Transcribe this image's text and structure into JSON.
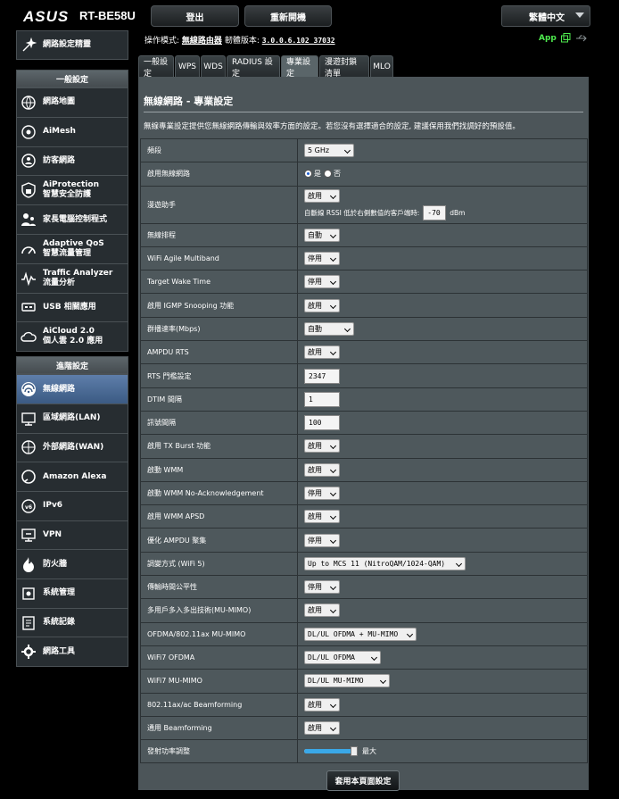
{
  "header": {
    "logo": "ASUS",
    "model": "RT-BE58U",
    "logout_label": "登出",
    "reboot_label": "重新開機",
    "language": "繁體中文"
  },
  "status": {
    "mode_label": "操作模式:",
    "mode_value": "無線路由器",
    "fw_label": "韌體版本:",
    "fw_value": "3.0.0.6.102_37032",
    "app_label": "App"
  },
  "sidebar": {
    "quick": "網路設定精靈",
    "general_header": "一般設定",
    "general": [
      {
        "label": "網路地圖",
        "icon": "globe-icon"
      },
      {
        "label": "AiMesh",
        "icon": "aimesh-icon"
      },
      {
        "label": "訪客網路",
        "icon": "guest-network-icon"
      },
      {
        "label": "AiProtection\n智慧安全防護",
        "icon": "shield-icon"
      },
      {
        "label": "家長電腦控制程式",
        "icon": "parental-control-icon"
      },
      {
        "label": "Adaptive QoS\n智慧流量管理",
        "icon": "qos-icon"
      },
      {
        "label": "Traffic Analyzer\n流量分析",
        "icon": "traffic-icon"
      },
      {
        "label": "USB 相關應用",
        "icon": "usb-icon"
      },
      {
        "label": "AiCloud 2.0\n個人雲 2.0 應用",
        "icon": "cloud-icon"
      }
    ],
    "advanced_header": "進階設定",
    "advanced": [
      {
        "label": "無線網路",
        "icon": "wireless-icon",
        "active": true
      },
      {
        "label": "區域網路(LAN)",
        "icon": "lan-icon"
      },
      {
        "label": "外部網路(WAN)",
        "icon": "wan-icon"
      },
      {
        "label": "Amazon Alexa",
        "icon": "alexa-icon"
      },
      {
        "label": "IPv6",
        "icon": "ipv6-icon"
      },
      {
        "label": "VPN",
        "icon": "vpn-icon"
      },
      {
        "label": "防火牆",
        "icon": "firewall-icon"
      },
      {
        "label": "系統管理",
        "icon": "admin-icon"
      },
      {
        "label": "系統記錄",
        "icon": "log-icon"
      },
      {
        "label": "網路工具",
        "icon": "tools-icon"
      }
    ]
  },
  "tabs": [
    "一般設定",
    "WPS",
    "WDS",
    "RADIUS 設定",
    "專業設定",
    "漫遊封鎖清單",
    "MLO"
  ],
  "active_tab": 4,
  "panel": {
    "title": "無線網路 - 專業設定",
    "description": "無線專業設定提供您無線網路傳輸與效率方面的設定。若您沒有選擇適合的設定, 建議保用我們找調好的預設值。",
    "apply_label": "套用本頁面設定"
  },
  "settings": [
    {
      "label": "頻段",
      "type": "select",
      "value": "5 GHz",
      "w": 56
    },
    {
      "label": "啟用無線網路",
      "type": "radio",
      "yes": "是",
      "no": "否",
      "selected": "yes"
    },
    {
      "label": "漫遊助手",
      "type": "roaming",
      "value": "啟用",
      "hint": "自斷線 RSSI 低於右側數值的客戶端時:",
      "rssi": "-70",
      "unit": "dBm"
    },
    {
      "label": "無線排程",
      "type": "select",
      "value": "自動",
      "w": 40
    },
    {
      "label": "WiFi Agile Multiband",
      "type": "select",
      "value": "停用",
      "w": 40
    },
    {
      "label": "Target Wake Time",
      "type": "select",
      "value": "停用",
      "w": 40
    },
    {
      "label": "啟用 IGMP Snooping 功能",
      "type": "select",
      "value": "啟用",
      "w": 40
    },
    {
      "label": "群播速率(Mbps)",
      "type": "select",
      "value": "自動",
      "w": 56
    },
    {
      "label": "AMPDU RTS",
      "type": "select",
      "value": "啟用",
      "w": 40
    },
    {
      "label": "RTS 門檻設定",
      "type": "input",
      "value": "2347",
      "w": 40
    },
    {
      "label": "DTIM 間隔",
      "type": "input",
      "value": "1",
      "w": 40
    },
    {
      "label": "訊號間隔",
      "type": "input",
      "value": "100",
      "w": 40
    },
    {
      "label": "啟用 TX Burst 功能",
      "type": "select",
      "value": "啟用",
      "w": 40
    },
    {
      "label": "啟動 WMM",
      "type": "select",
      "value": "啟用",
      "w": 40
    },
    {
      "label": "啟動 WMM No-Acknowledgement",
      "type": "select",
      "value": "停用",
      "w": 40
    },
    {
      "label": "啟用 WMM APSD",
      "type": "select",
      "value": "啟用",
      "w": 40
    },
    {
      "label": "優化 AMPDU 聚集",
      "type": "select",
      "value": "停用",
      "w": 40
    },
    {
      "label": "調變方式 (WiFi 5)",
      "type": "select",
      "value": "Up to MCS 11 (NitroQAM/1024-QAM)",
      "w": 181,
      "mono": true
    },
    {
      "label": "傳輸時間公平性",
      "type": "select",
      "value": "停用",
      "w": 40
    },
    {
      "label": "多用戶多入多出技術(MU-MIMO)",
      "type": "select",
      "value": "啟用",
      "w": 40
    },
    {
      "label": "OFDMA/802.11ax MU-MIMO",
      "type": "select",
      "value": "DL/UL OFDMA + MU-MIMO",
      "w": 126,
      "mono": true
    },
    {
      "label": "WiFi7 OFDMA",
      "type": "select",
      "value": "DL/UL OFDMA",
      "w": 86,
      "mono": true
    },
    {
      "label": "WiFi7 MU-MIMO",
      "type": "select",
      "value": "DL/UL MU-MIMO",
      "w": 96,
      "mono": true
    },
    {
      "label": "802.11ax/ac Beamforming",
      "type": "select",
      "value": "啟用",
      "w": 40
    },
    {
      "label": "通用 Beamforming",
      "type": "select",
      "value": "啟用",
      "w": 40
    },
    {
      "label": "發射功率調整",
      "type": "slider",
      "value": "最大",
      "level": 1.0
    }
  ],
  "colors": {
    "active_nav": "#4a6b95",
    "app_green": "#4eea4e",
    "panel": "#4c5559"
  }
}
